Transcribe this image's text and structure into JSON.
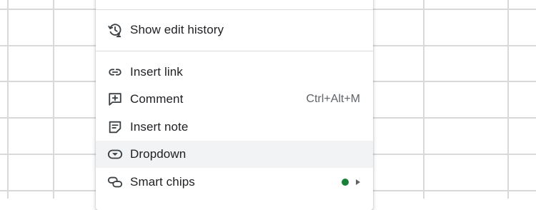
{
  "menu": {
    "items": [
      {
        "label": "Show edit history",
        "icon": "edit-history-icon"
      },
      {
        "label": "Insert link",
        "icon": "link-icon"
      },
      {
        "label": "Comment",
        "icon": "comment-add-icon",
        "shortcut": "Ctrl+Alt+M"
      },
      {
        "label": "Insert note",
        "icon": "note-icon"
      },
      {
        "label": "Dropdown",
        "icon": "dropdown-icon",
        "hovered": true
      },
      {
        "label": "Smart chips",
        "icon": "smart-chips-icon",
        "has_submenu": true,
        "badge": "new-feature-dot"
      }
    ]
  },
  "colors": {
    "hover_background": "#f1f3f4",
    "badge_dot": "#188038",
    "grid_line": "#d9d9d9",
    "text": "#202124",
    "muted_text": "#5f6368"
  }
}
